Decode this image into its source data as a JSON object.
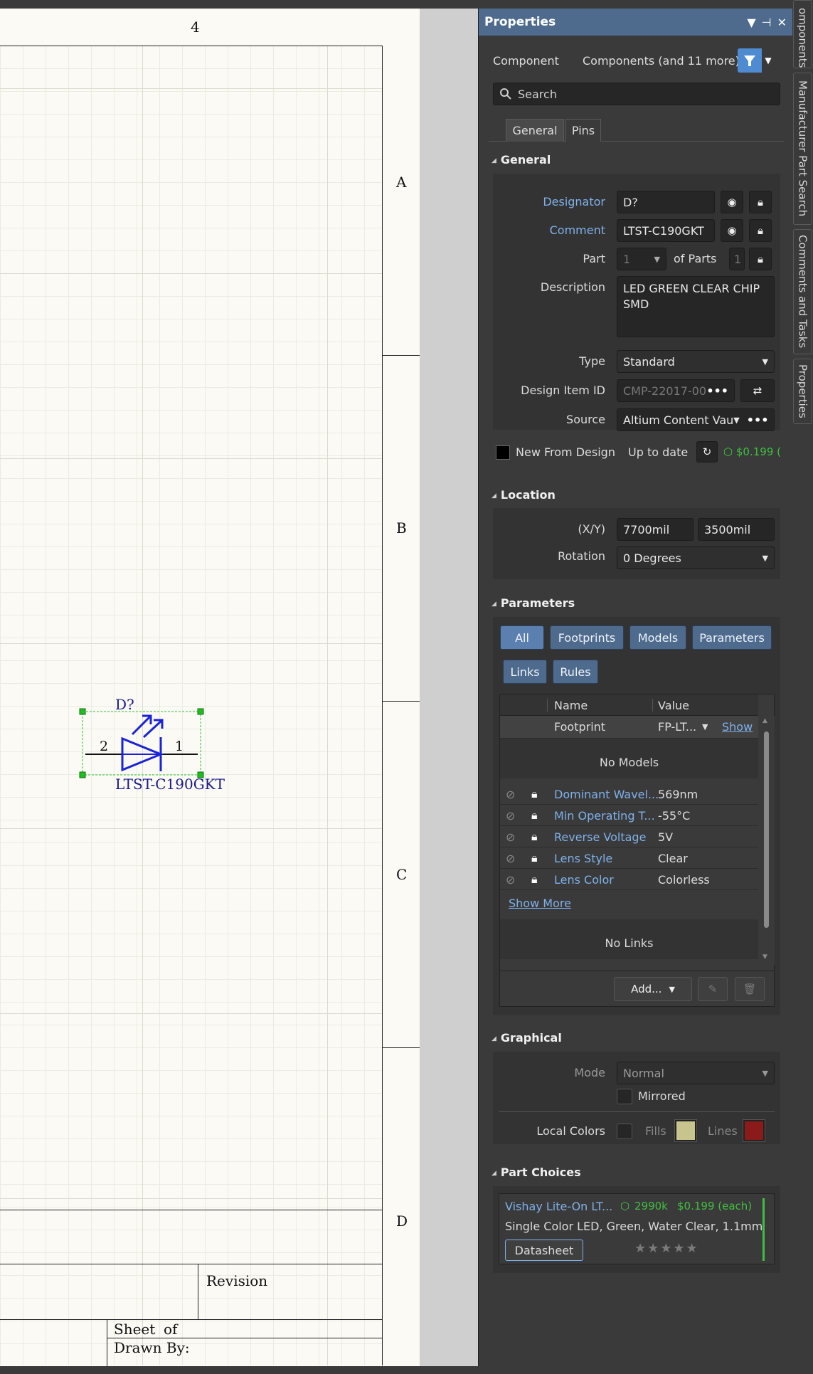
{
  "schematic": {
    "column_label": "4",
    "zone_labels": [
      "A",
      "B",
      "C",
      "D"
    ],
    "component": {
      "designator": "D?",
      "comment": "LTST-C190GKT",
      "pin_left": "2",
      "pin_right": "1"
    },
    "title_block": {
      "revision": "Revision",
      "sheet": "Sheet",
      "of": "of",
      "drawn_by": "Drawn By:"
    }
  },
  "panel": {
    "title": "Properties",
    "filter_left": "Component",
    "filter_right": "Components (and 11 more)",
    "search_placeholder": "Search",
    "tabs": [
      "General",
      "Pins"
    ],
    "general": {
      "title": "General",
      "designator_label": "Designator",
      "designator_value": "D?",
      "comment_label": "Comment",
      "comment_value": "LTST-C190GKT",
      "part_label": "Part",
      "part_value": "1",
      "of_parts_label": "of Parts",
      "of_parts_value": "1",
      "description_label": "Description",
      "description_value": "LED GREEN CLEAR CHIP SMD",
      "type_label": "Type",
      "type_value": "Standard",
      "design_item_label": "Design Item ID",
      "design_item_value": "CMP-22017-00",
      "source_label": "Source",
      "source_value": "Altium Content Vau",
      "new_from_design": "New From Design",
      "up_to_date": "Up to date",
      "price": "$0.199 ("
    },
    "location": {
      "title": "Location",
      "xy_label": "(X/Y)",
      "x_value": "7700mil",
      "y_value": "3500mil",
      "rotation_label": "Rotation",
      "rotation_value": "0 Degrees"
    },
    "parameters": {
      "title": "Parameters",
      "filters": [
        "All",
        "Footprints",
        "Models",
        "Parameters",
        "Links",
        "Rules"
      ],
      "col_name": "Name",
      "col_value": "Value",
      "footprint_name": "Footprint",
      "footprint_value": "FP-LT...",
      "footprint_show": "Show",
      "no_models": "No Models",
      "rows": [
        {
          "name": "Dominant Wavel...",
          "value": "569nm"
        },
        {
          "name": "Min Operating T...",
          "value": "-55°C"
        },
        {
          "name": "Reverse Voltage",
          "value": "5V"
        },
        {
          "name": "Lens Style",
          "value": "Clear"
        },
        {
          "name": "Lens Color",
          "value": "Colorless"
        }
      ],
      "show_more": "Show More",
      "no_links": "No Links",
      "add_label": "Add..."
    },
    "graphical": {
      "title": "Graphical",
      "mode_label": "Mode",
      "mode_value": "Normal",
      "mirrored_label": "Mirrored",
      "local_colors_label": "Local Colors",
      "fills_label": "Fills",
      "lines_label": "Lines",
      "fill_color": "#c8c48e",
      "line_color": "#8b1a1a"
    },
    "part_choices": {
      "title": "Part Choices",
      "vendor": "Vishay Lite-On LT...",
      "stock": "2990k",
      "price": "$0.199 (each)",
      "description": "Single Color LED, Green, Water Clear, 1.1mm",
      "datasheet": "Datasheet",
      "rating": "★★★★★"
    }
  },
  "side_tabs": [
    "omponents",
    "Manufacturer Part Search",
    "Comments and Tasks",
    "Properties"
  ]
}
